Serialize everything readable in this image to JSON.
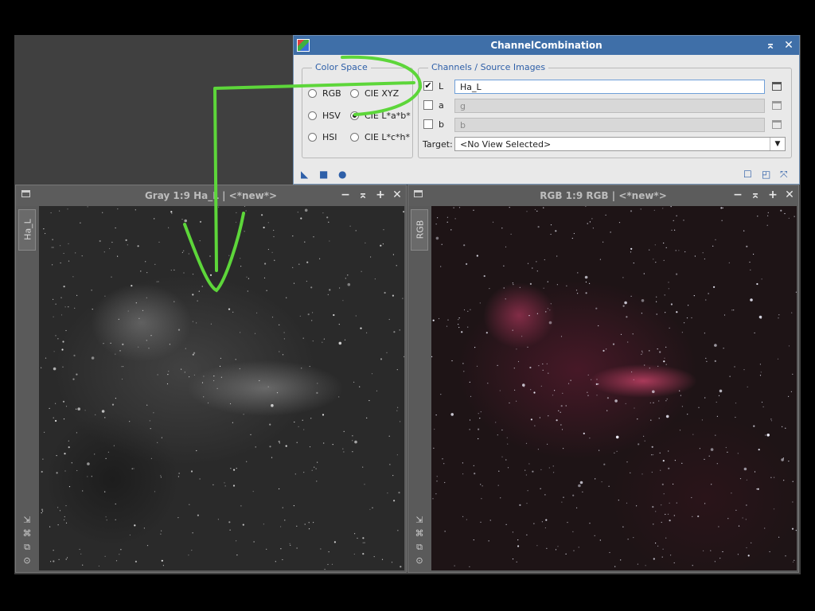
{
  "dialog": {
    "title": "ChannelCombination",
    "color_space": {
      "legend": "Color Space",
      "options": [
        {
          "label": "RGB",
          "selected": false
        },
        {
          "label": "CIE XYZ",
          "selected": false
        },
        {
          "label": "HSV",
          "selected": false
        },
        {
          "label": "CIE L*a*b*",
          "selected": true
        },
        {
          "label": "HSI",
          "selected": false
        },
        {
          "label": "CIE L*c*h*",
          "selected": false
        }
      ]
    },
    "channels": {
      "legend": "Channels / Source Images",
      "rows": [
        {
          "label": "L",
          "checked": true,
          "value": "Ha_L"
        },
        {
          "label": "a",
          "checked": false,
          "value": "g"
        },
        {
          "label": "b",
          "checked": false,
          "value": "b"
        }
      ],
      "target_label": "Target:",
      "target_value": "<No View Selected>"
    }
  },
  "windows": {
    "left": {
      "title": "Gray 1:9 Ha_L | <*new*>",
      "tab": "Ha_L"
    },
    "right": {
      "title": "RGB 1:9 RGB | <*new*>",
      "tab": "RGB"
    }
  },
  "colors": {
    "title_accent": "#3f6fa8",
    "annotation_arrow": "#5dd63a"
  }
}
